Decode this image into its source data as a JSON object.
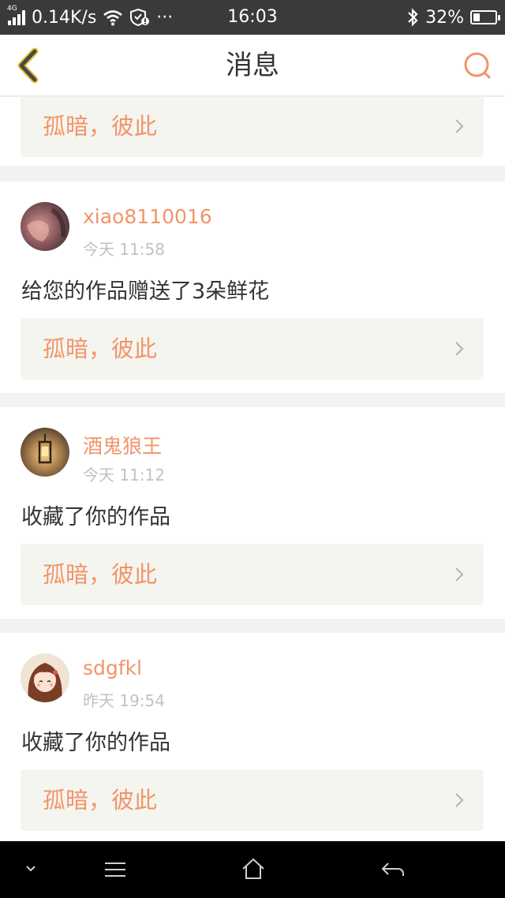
{
  "status_bar": {
    "network_type": "4G",
    "speed": "0.14K/s",
    "more": "···",
    "time": "16:03",
    "battery": "32%",
    "battery_level": 0.32
  },
  "header": {
    "title": "消息",
    "accent_color": "#f0956a"
  },
  "partial_item": {
    "work_title": "孤暗，彼此"
  },
  "notifications": [
    {
      "username": "xiao8110016",
      "time": "今天 11:58",
      "message": "给您的作品赠送了3朵鲜花",
      "work_title": "孤暗，彼此"
    },
    {
      "username": "酒鬼狼王",
      "time": "今天 11:12",
      "message": "收藏了你的作品",
      "work_title": "孤暗，彼此"
    },
    {
      "username": "sdgfkl",
      "time": "昨天 19:54",
      "message": "收藏了你的作品",
      "work_title": "孤暗，彼此"
    }
  ],
  "nav_icons": [
    "chevron-down-icon",
    "menu-icon",
    "home-icon",
    "back-arrow-icon"
  ]
}
